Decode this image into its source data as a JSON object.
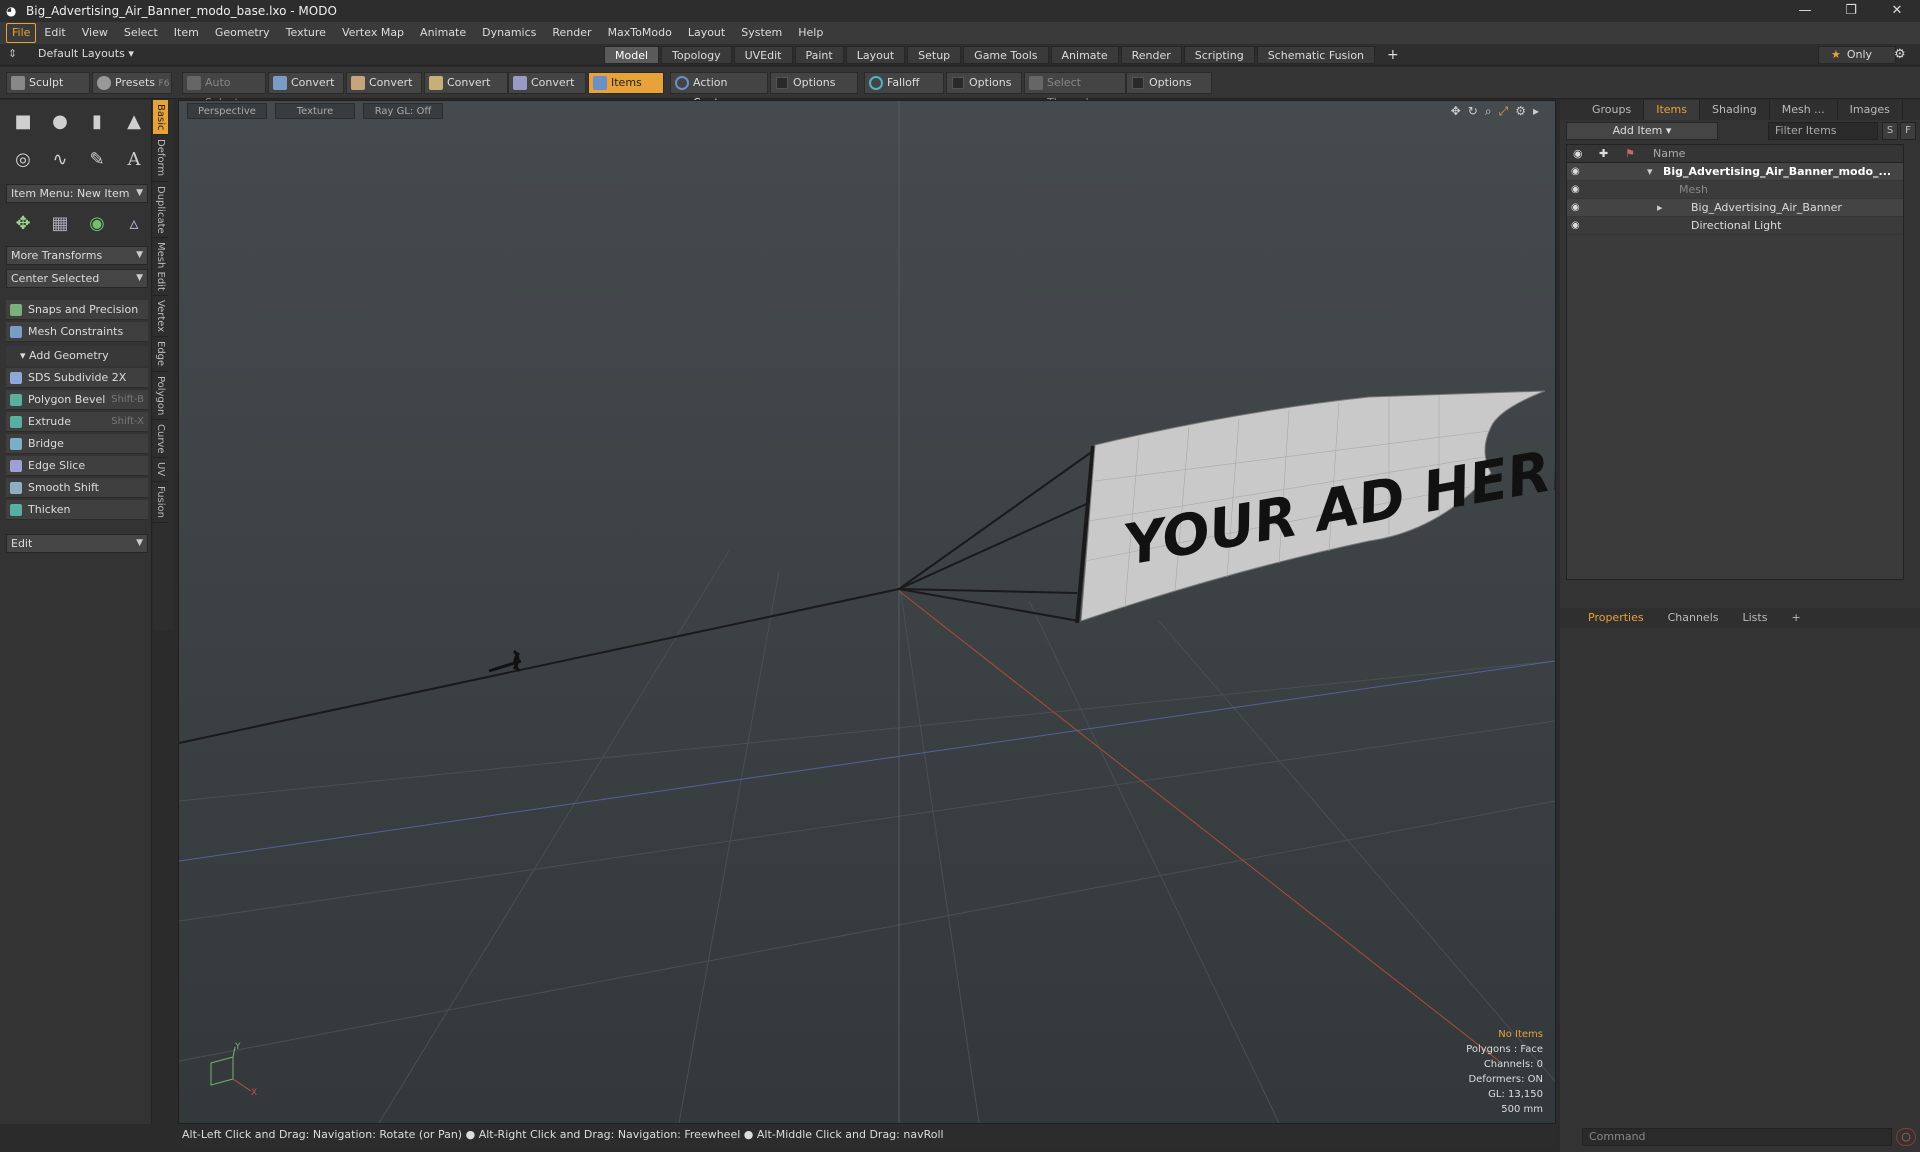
{
  "window": {
    "title": "Big_Advertising_Air_Banner_modo_base.lxo - MODO"
  },
  "menu": [
    "File",
    "Edit",
    "View",
    "Select",
    "Item",
    "Geometry",
    "Texture",
    "Vertex Map",
    "Animate",
    "Dynamics",
    "Render",
    "MaxToModo",
    "Layout",
    "System",
    "Help"
  ],
  "layouts": {
    "label": "Default Layouts",
    "tabs": [
      "Model",
      "Topology",
      "UVEdit",
      "Paint",
      "Layout",
      "Setup",
      "Game Tools",
      "Animate",
      "Render",
      "Scripting",
      "Schematic Fusion"
    ],
    "active": "Model",
    "only": "Only"
  },
  "toolbar": {
    "sculpt": "Sculpt",
    "presets": "Presets",
    "presets_key": "F6",
    "auto_select": "Auto Select",
    "convert1": "Convert",
    "convert2": "Convert",
    "convert3": "Convert",
    "convert4": "Convert",
    "items": "Items",
    "action_center": "Action Center",
    "options1": "Options",
    "falloff": "Falloff",
    "options2": "Options",
    "select_through": "Select Through",
    "options3": "Options"
  },
  "left": {
    "item_menu": "Item Menu: New Item",
    "more_transforms": "More Transforms",
    "center_selected": "Center Selected",
    "snaps": "Snaps and Precision",
    "constraints": "Mesh Constraints",
    "add_geometry": "Add Geometry",
    "tools": [
      {
        "label": "SDS Subdivide 2X",
        "key": ""
      },
      {
        "label": "Polygon Bevel",
        "key": "Shift-B"
      },
      {
        "label": "Extrude",
        "key": "Shift-X"
      },
      {
        "label": "Bridge",
        "key": ""
      },
      {
        "label": "Edge Slice",
        "key": ""
      },
      {
        "label": "Smooth Shift",
        "key": ""
      },
      {
        "label": "Thicken",
        "key": ""
      }
    ],
    "edit": "Edit",
    "vtabs": [
      "Basic",
      "Deform",
      "Duplicate",
      "Mesh Edit",
      "Vertex",
      "Edge",
      "Polygon",
      "Curve",
      "UV",
      "Fusion"
    ]
  },
  "viewport": {
    "view": "Perspective",
    "shading": "Texture",
    "raygl": "Ray GL: Off",
    "banner_text": "YOUR AD HERE",
    "stats": {
      "sel": "No Items",
      "polygons": "Polygons : Face",
      "channels": "Channels: 0",
      "deformers": "Deformers: ON",
      "gl": "GL: 13,150",
      "scale": "500 mm"
    },
    "axis_y": "Y",
    "axis_x": "X"
  },
  "status": "Alt-Left Click and Drag: Navigation: Rotate (or Pan) ● Alt-Right Click and Drag: Navigation: Freewheel ● Alt-Middle Click and Drag: navRoll",
  "right": {
    "tabs": [
      "Groups",
      "Items",
      "Shading",
      "Mesh ...",
      "Images"
    ],
    "add_item": "Add Item",
    "filter": "Filter Items",
    "s": "S",
    "f": "F",
    "col_name": "Name",
    "items": [
      {
        "label": "Big_Advertising_Air_Banner_modo_...",
        "bold": true
      },
      {
        "label": "Mesh",
        "dim": true
      },
      {
        "label": "Big_Advertising_Air_Banner"
      },
      {
        "label": "Directional Light"
      }
    ],
    "prop_tabs": [
      "Properties",
      "Channels",
      "Lists"
    ],
    "command": "Command"
  }
}
